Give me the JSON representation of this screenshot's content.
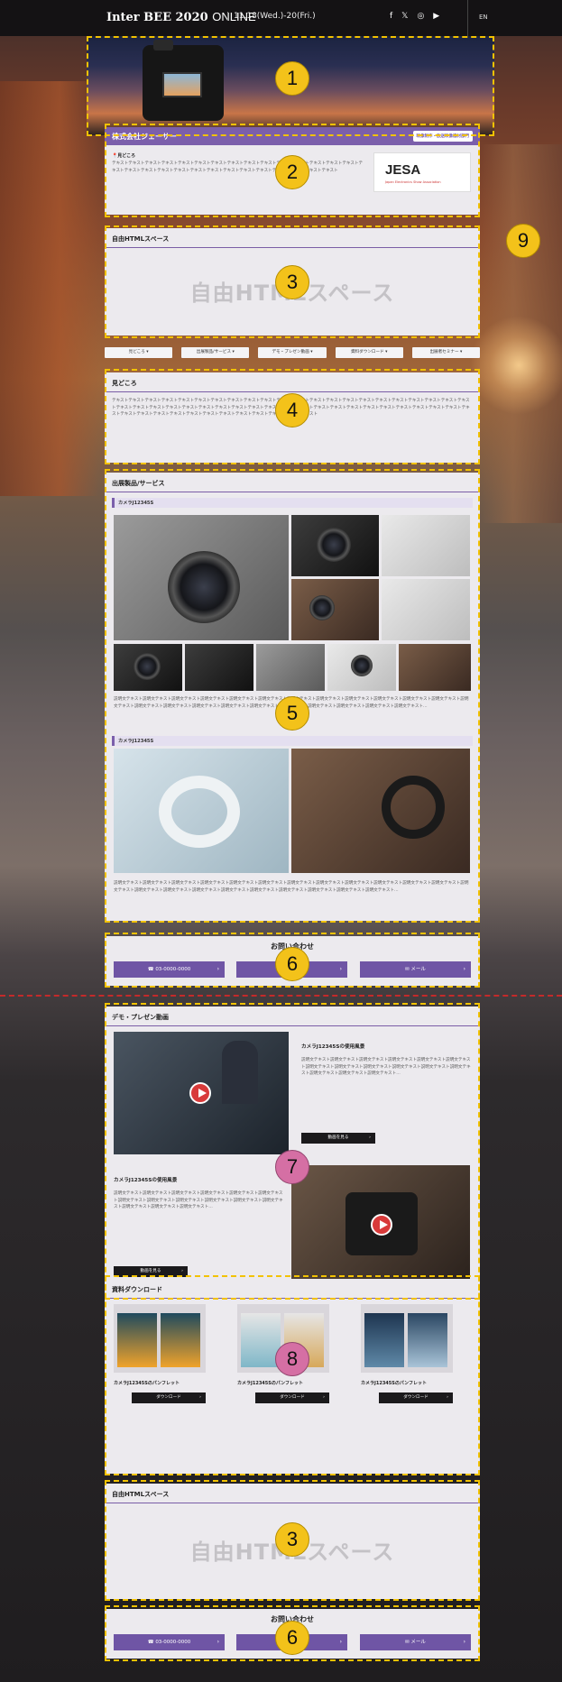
{
  "topbar": {
    "brand": "Inter BEE 2020",
    "brand_suffix": "ONLINE",
    "dates": "11.18(Wed.)-20(Fri.)",
    "social": [
      "f",
      "𝕏",
      "◎",
      "▶"
    ],
    "lang": "EN"
  },
  "markers": {
    "n1": "1",
    "n2": "2",
    "n3a": "3",
    "n3b": "3",
    "n4": "4",
    "n5": "5",
    "n6a": "6",
    "n6b": "6",
    "n7": "7",
    "n8": "8",
    "n9": "9"
  },
  "company": {
    "name": "株式会社ジェーサー",
    "badge": "映像制作・放送映像機材部門",
    "pin_label": "見どころ",
    "text": "テキストテキストテキストテキストテキストテキストテキストテキストテキストテキストテキストテキストテキストテキストテキストテキストテキストテキストテキストテキストテキストテキストテキストテキストテキストテキストテキストテキストテキスト",
    "logo": "JESA",
    "logo_sub": "Japan Electronics Show Association"
  },
  "free1": {
    "title": "自由HTMLスペース",
    "big": "自由HTMLスペース"
  },
  "nav": [
    "見どころ ▾",
    "出展製品/サービス ▾",
    "デモ・プレゼン動画 ▾",
    "資料ダウンロード ▾",
    "出展者セミナー ▾"
  ],
  "highlights": {
    "title": "見どころ",
    "text": "テキストテキストテキストテキストテキストテキストテキストテキストテキストテキストテキストテキストテキストテキストテキストテキストテキストテキストテキストテキストテキストテキストテキストテキストテキストテキストテキストテキストテキストテキストテキストテキストテキストテキストテキストテキストテキストテキストテキストテキストテキストテキストテキストテキストテキストテキストテキストテキストテキストテキストテキストテキストテキストテキストテキストテキスト"
  },
  "products": {
    "title": "出展製品/サービス",
    "items": [
      {
        "name": "カメラJ12345S",
        "desc": "説明文テキスト説明文テキスト説明文テキスト説明文テキスト説明文テキスト説明文テキスト説明文テキスト説明文テキスト説明文テキスト説明文テキスト説明文テキスト説明文テキスト説明文テキスト説明文テキスト説明文テキスト説明文テキスト説明文テキスト説明文テキスト説明文テキスト説明文テキスト説明文テキスト説明文テキスト説明文テキスト…"
      },
      {
        "name": "カメラJ12345S",
        "desc": "説明文テキスト説明文テキスト説明文テキスト説明文テキスト説明文テキスト説明文テキスト説明文テキスト説明文テキスト説明文テキスト説明文テキスト説明文テキスト説明文テキスト説明文テキスト説明文テキスト説明文テキスト説明文テキスト説明文テキスト説明文テキスト説明文テキスト説明文テキスト説明文テキスト説明文テキスト…"
      }
    ]
  },
  "contact": {
    "title": "お問い合わせ",
    "phone": "03-0000-0000",
    "mail": "メール",
    "arrow": "›"
  },
  "demo": {
    "title": "デモ・プレゼン動画",
    "videos": [
      {
        "title": "カメラJ12345Sの使用風景",
        "desc": "説明文テキスト説明文テキスト説明文テキスト説明文テキスト説明文テキスト説明文テキスト説明文テキスト説明文テキスト説明文テキスト説明文テキスト説明文テキスト説明文テキスト説明文テキスト説明文テキスト説明文テキスト…",
        "button": "動画を見る"
      },
      {
        "title": "カメラJ12345Sの使用風景",
        "desc": "説明文テキスト説明文テキスト説明文テキスト説明文テキスト説明文テキスト説明文テキスト説明文テキスト説明文テキスト説明文テキスト説明文テキスト説明文テキスト説明文テキスト説明文テキスト説明文テキスト説明文テキスト…",
        "button": "動画を見る"
      }
    ]
  },
  "downloads": {
    "title": "資料ダウンロード",
    "items": [
      {
        "name": "カメラJ12345Sのパンフレット",
        "button": "ダウンロード"
      },
      {
        "name": "カメラJ12345Sのパンフレット",
        "button": "ダウンロード"
      },
      {
        "name": "カメラJ12345Sのパンフレット",
        "button": "ダウンロード"
      }
    ]
  },
  "free2": {
    "title": "自由HTMLスペース",
    "big": "自由HTMLスペース"
  },
  "colors": {
    "accent": "#7b5fab",
    "marker": "#f3c21a",
    "marker_pink": "#d56fa4",
    "dash": "#f2c200"
  }
}
